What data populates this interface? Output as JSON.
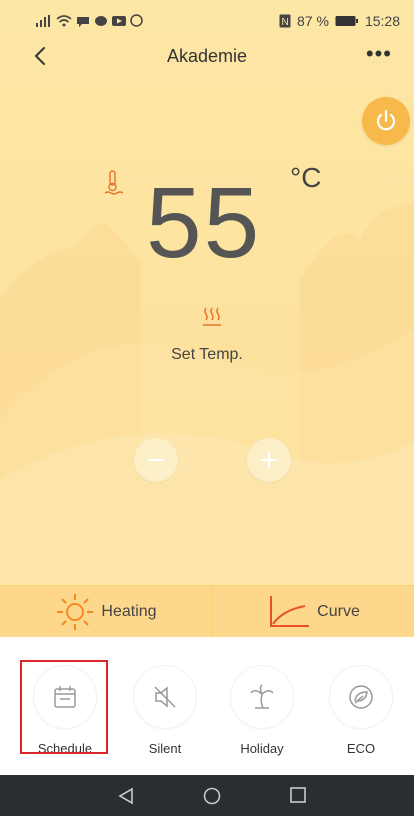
{
  "status_bar": {
    "battery": "87 %",
    "time": "15:28",
    "icons": [
      "signal-icon",
      "wifi-icon",
      "chat-icon",
      "youtube-icon",
      "whatsapp-icon",
      "nfc-icon",
      "battery-icon"
    ]
  },
  "header": {
    "title": "Akademie",
    "back_icon": "chevron-left-icon",
    "more_icon": "more-icon"
  },
  "temperature": {
    "value": "55",
    "unit": "°C",
    "icon": "water-temp-icon"
  },
  "setpoint": {
    "label": "Set Temp.",
    "icon": "heat-waves-icon"
  },
  "controls": {
    "power_icon": "power-icon",
    "minus_icon": "minus-icon",
    "plus_icon": "plus-icon"
  },
  "modes": [
    {
      "label": "Heating",
      "icon": "sun-icon"
    },
    {
      "label": "Curve",
      "icon": "curve-icon"
    }
  ],
  "functions": [
    {
      "label": "Schedule",
      "icon": "calendar-icon"
    },
    {
      "label": "Silent",
      "icon": "mute-icon"
    },
    {
      "label": "Holiday",
      "icon": "palm-icon"
    },
    {
      "label": "ECO",
      "icon": "leaf-icon"
    }
  ],
  "nav": {
    "back": "nav-back-icon",
    "home": "nav-home-icon",
    "recent": "nav-recent-icon"
  },
  "colors": {
    "accent": "#f6b94a",
    "heating_icon": "#f58a1e",
    "curve_icon": "#e8502c",
    "highlight": "#d9262c"
  }
}
